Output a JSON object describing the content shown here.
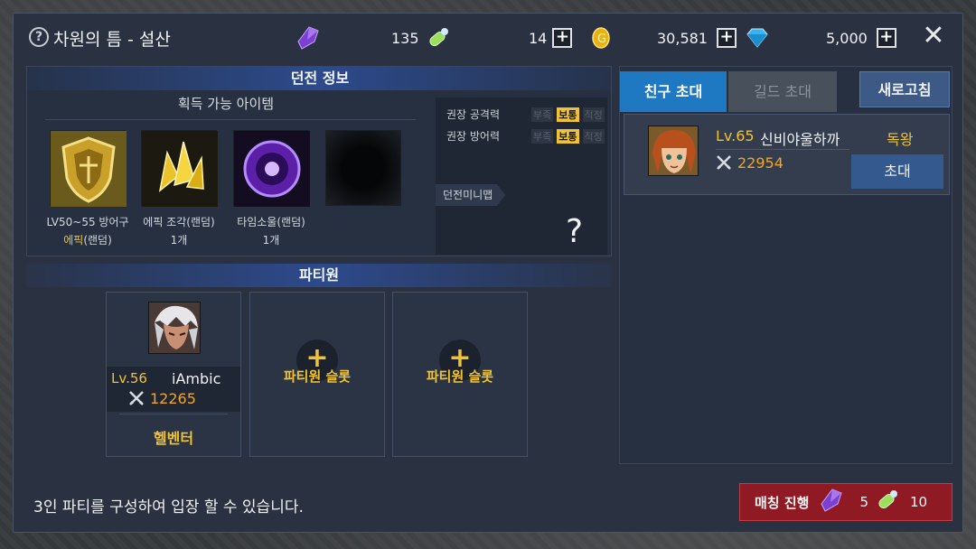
{
  "header": {
    "title": "차원의 틈 - 설산",
    "help_icon": "question-circle-icon",
    "resources": [
      {
        "icon": "purple-crystal-icon",
        "value": "135"
      },
      {
        "icon": "green-potion-icon",
        "value": "14"
      },
      {
        "icon": "gold-coin-icon",
        "value": "30,581"
      },
      {
        "icon": "blue-diamond-icon",
        "value": "5,000"
      }
    ],
    "close_icon": "close-x-icon"
  },
  "dungeon_info": {
    "header": "던전 정보",
    "items_title": "획득 가능 아이템",
    "items": [
      {
        "name": "LV50~55 방어구",
        "grade": "에픽",
        "suffix": "(랜덤)",
        "icon": "golden-shield-icon"
      },
      {
        "name": "에픽 조각(랜덤)",
        "count": "1개",
        "icon": "gold-shard-icon"
      },
      {
        "name": "타임소울(랜덤)",
        "count": "1개",
        "icon": "purple-orb-icon"
      },
      {
        "name": "",
        "count": "",
        "icon": "empty-slot"
      }
    ],
    "stats": [
      {
        "label": "권장 공격력",
        "tags": [
          "부족",
          "보통",
          "적정"
        ],
        "active": "보통"
      },
      {
        "label": "권장 방어력",
        "tags": [
          "부족",
          "보통",
          "적정"
        ],
        "active": "보통"
      }
    ],
    "minimap_label": "던전미니맵",
    "minimap_unknown": "?"
  },
  "party": {
    "header": "파티원",
    "members": [
      {
        "level": "Lv.56",
        "name": "iAmbic",
        "power": "12265",
        "class": "헬벤터"
      }
    ],
    "empty_slot_label": "파티원 슬롯"
  },
  "invite": {
    "tab_friend": "친구 초대",
    "tab_guild": "길드 초대",
    "refresh": "새로고침",
    "friends": [
      {
        "level": "Lv.65",
        "name": "신비야울하까",
        "power": "22954",
        "class": "독왕",
        "invite_label": "초대"
      }
    ]
  },
  "footer": {
    "notice": "3인 파티를 구성하여 입장 할 수 있습니다.",
    "match_label": "매칭 진행",
    "cost_crystal": "5",
    "cost_potion": "10"
  },
  "colors": {
    "accent_gold": "#f1c232",
    "tab_blue": "#1f78c2",
    "match_red": "#8f1a24"
  }
}
